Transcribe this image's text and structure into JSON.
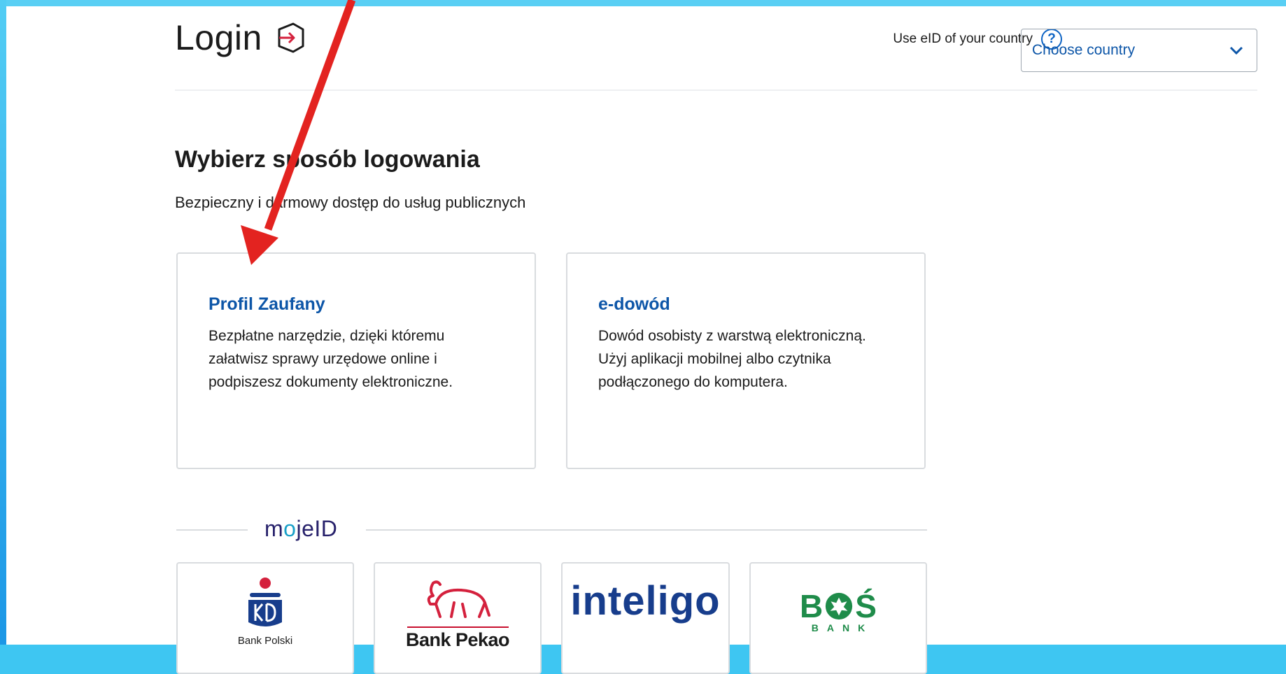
{
  "header": {
    "title": "Login",
    "eid_text": "Use eID of your country",
    "help_glyph": "?",
    "country_select": {
      "value": "Choose country"
    }
  },
  "main": {
    "heading": "Wybierz sposób logowania",
    "subheading": "Bezpieczny i darmowy dostęp do usług publicznych",
    "cards": [
      {
        "title": "Profil Zaufany",
        "description": "Bezpłatne narzędzie, dzięki któremu załatwisz sprawy urzędowe online i podpiszesz dokumenty elektroniczne."
      },
      {
        "title": "e-dowód",
        "description": "Dowód osobisty z warstwą elektroniczną. Użyj aplikacji mobilnej albo czytnika podłączonego do komputera."
      }
    ],
    "mojeid": {
      "logo_prefix": "m",
      "logo_o": "o",
      "logo_suffix": "jeID"
    },
    "banks": [
      {
        "name": "Bank Polski",
        "icon": "pko-logo"
      },
      {
        "name": "Bank Pekao",
        "icon": "pekao-bison-logo"
      },
      {
        "name": "inteligo",
        "icon": "inteligo-logo"
      },
      {
        "name": "BANK",
        "logo_text": "B",
        "logo_text_end": "Ś",
        "icon": "bos-logo"
      }
    ]
  },
  "colors": {
    "accent": "#0d56a8",
    "frame": "#3ec6f2",
    "arrow": "#e32320"
  }
}
